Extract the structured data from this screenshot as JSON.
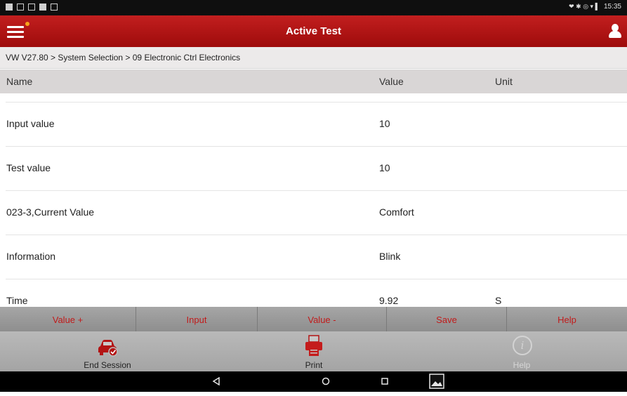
{
  "status_bar": {
    "time": "15:35",
    "right_icons": "❤ ✱ ◎ ▾ ▌"
  },
  "header": {
    "title": "Active Test"
  },
  "breadcrumb": "VW V27.80 > System Selection > 09 Electronic Ctrl Electronics",
  "table": {
    "columns": {
      "name": "Name",
      "value": "Value",
      "unit": "Unit"
    },
    "rows": [
      {
        "name": "Input value",
        "value": "10",
        "unit": ""
      },
      {
        "name": "Test value",
        "value": "10",
        "unit": ""
      },
      {
        "name": "023-3,Current Value",
        "value": "Comfort",
        "unit": ""
      },
      {
        "name": "Information",
        "value": "Blink",
        "unit": ""
      },
      {
        "name": "Time",
        "value": "9.92",
        "unit": "S"
      }
    ]
  },
  "function_buttons": {
    "value_plus": "Value +",
    "input": "Input",
    "value_minus": "Value -",
    "save": "Save",
    "help": "Help"
  },
  "bottom_bar": {
    "end_session": "End Session",
    "print": "Print",
    "help": "Help",
    "help_enabled": false
  },
  "colors": {
    "accent": "#b31414",
    "button_text": "#c11a1a"
  },
  "icons": {
    "menu": "menu-icon",
    "user": "user-icon",
    "end_session": "car-icon",
    "print": "printer-icon",
    "help": "info-icon"
  }
}
